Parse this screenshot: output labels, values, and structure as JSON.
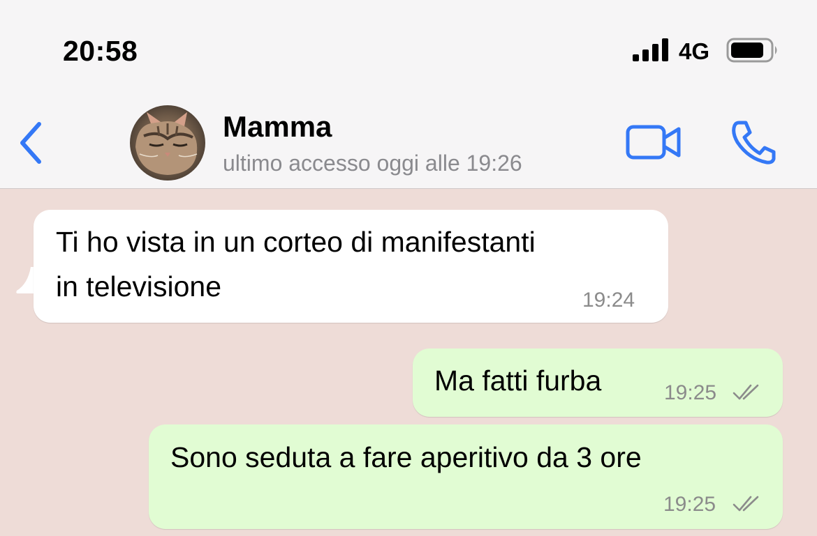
{
  "status_bar": {
    "time": "20:58",
    "network": "4G",
    "signal_icon": "cellular-signal-icon",
    "battery_icon": "battery-icon"
  },
  "header": {
    "contact_name": "Mamma",
    "last_seen": "ultimo accesso oggi alle 19:26",
    "back_icon": "chevron-left-icon",
    "video_icon": "video-camera-icon",
    "call_icon": "phone-icon",
    "accent_color": "#3478f6"
  },
  "chat": {
    "background_color": "#eedcd7",
    "messages": [
      {
        "direction": "incoming",
        "lines": [
          "Ti ho vista in un corteo di manifestanti",
          "in televisione"
        ],
        "time": "19:24"
      },
      {
        "direction": "outgoing",
        "lines": [
          "Ma fatti furba"
        ],
        "time": "19:25",
        "status_icon": "double-check-icon"
      },
      {
        "direction": "outgoing",
        "lines": [
          "Sono seduta a fare aperitivo da 3 ore"
        ],
        "time": "19:25",
        "status_icon": "double-check-icon"
      }
    ]
  }
}
